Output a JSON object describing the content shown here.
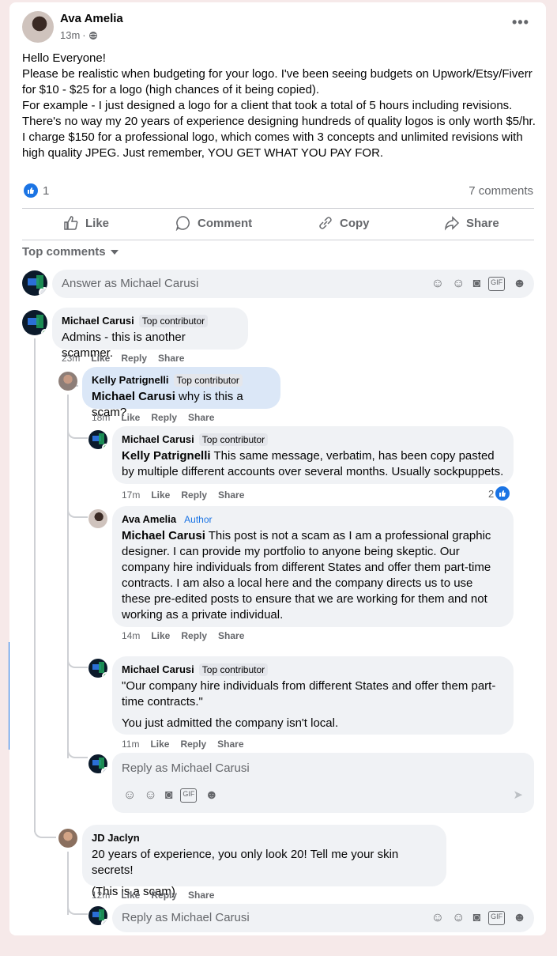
{
  "post": {
    "author": "Ava Amelia",
    "time": "13m",
    "privacy_icon": "globe-icon",
    "lines": [
      "Hello Everyone!",
      "Please be realistic when budgeting for your logo. I've been seeing budgets on Upwork/Etsy/Fiverr for $10 - $25 for a logo (high chances of it being copied).",
      "For example - I just designed a logo for a client that took a total of 5 hours including revisions. There's no way my 20 years of experience designing hundreds of quality logos is only worth $5/hr.",
      "I charge $150 for a professional logo, which comes with 3 concepts and unlimited revisions with high quality JPEG. Just remember, YOU GET WHAT YOU PAY FOR."
    ],
    "reaction_count": "1",
    "comments_count": "7 comments"
  },
  "actions": {
    "like": "Like",
    "comment": "Comment",
    "copy": "Copy",
    "share": "Share"
  },
  "filter": {
    "label": "Top comments"
  },
  "composer": {
    "placeholder": "Answer as Michael Carusi"
  },
  "comments": [
    {
      "name": "Michael Carusi",
      "badge": "Top contributor",
      "text": "Admins - this is another scammer.",
      "time": "23m",
      "like": "Like",
      "reply": "Reply",
      "share": "Share"
    },
    {
      "name": "Kelly Patrignelli",
      "badge": "Top contributor",
      "mention": "Michael Carusi",
      "text": " why is this a scam?",
      "time": "18m",
      "like": "Like",
      "reply": "Reply",
      "share": "Share"
    },
    {
      "name": "Michael Carusi",
      "badge": "Top contributor",
      "mention": "Kelly Patrignelli",
      "text": " This same message, verbatim, has been copy pasted by multiple different accounts over several months. Usually sockpuppets.",
      "time": "17m",
      "like": "Like",
      "reply": "Reply",
      "share": "Share",
      "reactions": "2"
    },
    {
      "name": "Ava Amelia",
      "badge": "Author",
      "mention": "Michael Carusi",
      "text": " This post is not a scam as I am a professional graphic designer. I can provide my portfolio to anyone being skeptic. Our company hire individuals from different States and offer them part-time contracts. I am also a local here and the company directs us to use these pre-edited posts to ensure that we are working for them and not working as a private individual.",
      "time": "14m",
      "like": "Like",
      "reply": "Reply",
      "share": "Share"
    },
    {
      "name": "Michael Carusi",
      "badge": "Top contributor",
      "text": "\"Our company hire individuals from different States and offer them part-time contracts.\"",
      "text2": "You just admitted the company isn't local.",
      "time": "11m",
      "like": "Like",
      "reply": "Reply",
      "share": "Share"
    },
    {
      "name": "JD Jaclyn",
      "text": "20 years of experience, you only look 20! Tell me your skin secrets!",
      "text2": "(This is a scam)",
      "time": "12m",
      "like": "Like",
      "reply": "Reply",
      "share": "Share"
    }
  ],
  "reply_box_1": {
    "placeholder": "Reply as Michael Carusi"
  },
  "reply_box_2": {
    "placeholder": "Reply as Michael Carusi"
  },
  "colors": {
    "accent": "#1b74e4",
    "bubble": "#f0f2f5",
    "highlight": "#dbe7f7",
    "muted": "#65676b"
  }
}
